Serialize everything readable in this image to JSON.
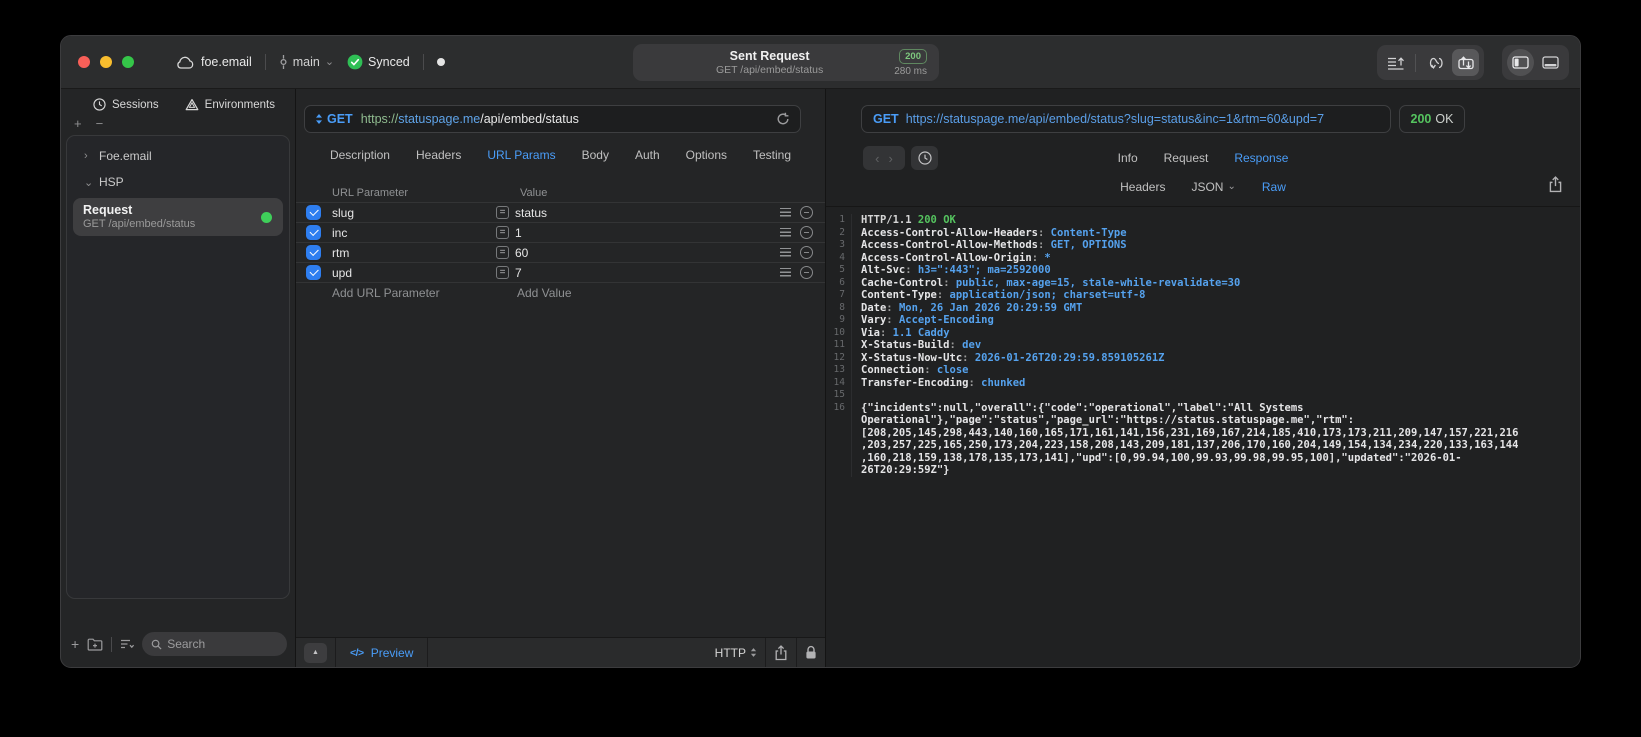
{
  "colors": {
    "accent": "#4a9df8",
    "badge-green": "#7ec87e",
    "code-green": "#55c45f",
    "value-blue": "#55a2ee",
    "scheme-green": "#8fbb8f",
    "host-blue": "#5fa3e7",
    "success-green": "#2fbf55"
  },
  "icons": {
    "plus": "+",
    "minus": "−",
    "equals": "=",
    "chevron_right": "›",
    "chevron_down": "⌄",
    "back": "‹",
    "forward": "›",
    "collapse": "▲",
    "code": "</>"
  },
  "titlebar": {
    "project": "foe.email",
    "branch": "main",
    "sync_label": "Synced",
    "request_title": "Sent Request",
    "request_subtitle": "GET /api/embed/status",
    "status_code": "200",
    "duration": "280 ms"
  },
  "sidebar": {
    "tabs": [
      {
        "label": "Sessions"
      },
      {
        "label": "Environments"
      }
    ],
    "tree": [
      {
        "label": "Foe.email",
        "expanded": false
      },
      {
        "label": "HSP",
        "expanded": true
      }
    ],
    "request": {
      "title": "Request",
      "subtitle": "GET /api/embed/status"
    },
    "search_placeholder": "Search"
  },
  "request_panel": {
    "method": "GET",
    "url": {
      "scheme": "https://",
      "host": "statuspage.me",
      "path": "/api/embed/status"
    },
    "tabs": [
      {
        "label": "Description"
      },
      {
        "label": "Headers"
      },
      {
        "label": "URL Params",
        "active": true
      },
      {
        "label": "Body"
      },
      {
        "label": "Auth"
      },
      {
        "label": "Options"
      },
      {
        "label": "Testing"
      }
    ],
    "table": {
      "columns": [
        "URL Parameter",
        "Value"
      ],
      "rows": [
        {
          "name": "slug",
          "value": "status",
          "enabled": true
        },
        {
          "name": "inc",
          "value": "1",
          "enabled": true
        },
        {
          "name": "rtm",
          "value": "60",
          "enabled": true
        },
        {
          "name": "upd",
          "value": "7",
          "enabled": true
        }
      ],
      "add_param_label": "Add URL Parameter",
      "add_value_label": "Add Value"
    },
    "footer": {
      "preview_label": "Preview",
      "protocol": "HTTP"
    }
  },
  "response_panel": {
    "method": "GET",
    "url": "https://statuspage.me/api/embed/status?slug=status&inc=1&rtm=60&upd=7",
    "status_code": "200",
    "status_text": "OK",
    "tabs": [
      {
        "label": "Info"
      },
      {
        "label": "Request"
      },
      {
        "label": "Response",
        "active": true
      }
    ],
    "subtabs": [
      {
        "label": "Headers"
      },
      {
        "label": "JSON",
        "dropdown": true
      },
      {
        "label": "Raw",
        "active": true
      }
    ],
    "status_line": {
      "protocol": "HTTP/1.1",
      "status": "200 OK"
    },
    "headers": [
      {
        "name": "Access-Control-Allow-Headers",
        "value": "Content-Type"
      },
      {
        "name": "Access-Control-Allow-Methods",
        "value": "GET, OPTIONS"
      },
      {
        "name": "Access-Control-Allow-Origin",
        "value": "*"
      },
      {
        "name": "Alt-Svc",
        "value": "h3=\":443\"; ma=2592000"
      },
      {
        "name": "Cache-Control",
        "value": "public, max-age=15, stale-while-revalidate=30"
      },
      {
        "name": "Content-Type",
        "value": "application/json; charset=utf-8"
      },
      {
        "name": "Date",
        "value": "Mon, 26 Jan 2026 20:29:59 GMT"
      },
      {
        "name": "Vary",
        "value": "Accept-Encoding"
      },
      {
        "name": "Via",
        "value": "1.1 Caddy"
      },
      {
        "name": "X-Status-Build",
        "value": "dev"
      },
      {
        "name": "X-Status-Now-Utc",
        "value": "2026-01-26T20:29:59.859105261Z"
      },
      {
        "name": "Connection",
        "value": "close"
      },
      {
        "name": "Transfer-Encoding",
        "value": "chunked"
      }
    ],
    "body": "{\"incidents\":null,\"overall\":{\"code\":\"operational\",\"label\":\"All Systems Operational\"},\"page\":\"status\",\"page_url\":\"https://status.statuspage.me\",\"rtm\":[208,205,145,298,443,140,160,165,171,161,141,156,231,169,167,214,185,410,173,173,211,209,147,157,221,216,203,257,225,165,250,173,204,223,158,208,143,209,181,137,206,170,160,204,149,154,134,234,220,133,163,144,160,218,159,138,178,135,173,141],\"upd\":[0,99.94,100,99.93,99.98,99.95,100],\"updated\":\"2026-01-26T20:29:59Z\"}"
  }
}
